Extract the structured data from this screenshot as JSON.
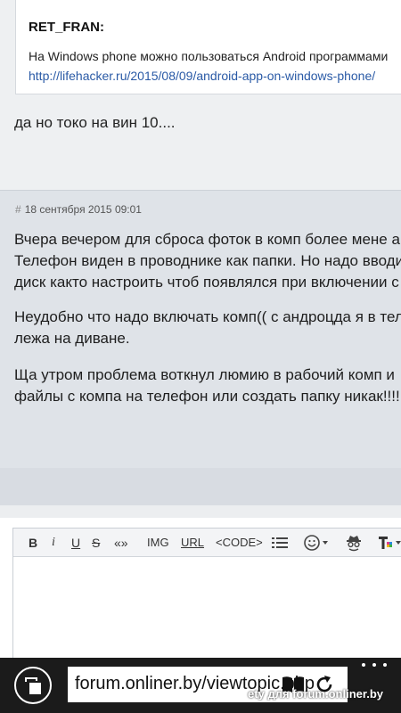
{
  "post1": {
    "quote_author": "RET_FRAN:",
    "quote_text": "На Windows phone можно пользоваться Android программами",
    "quote_link": "http://lifehacker.ru/2015/08/09/android-app-on-windows-phone/",
    "reply_text": "да но токо на вин 10...."
  },
  "post2": {
    "hash": "#",
    "date": "18 сентября 2015 09:01",
    "paragraphs": [
      [
        "Вчера вечером для сброса фоток в комп более мене а",
        "Телефон виден в проводнике как папки. Но надо вводи",
        "диск както настроить чтоб появлялся при включении с"
      ],
      [
        "Неудобно что надо включать комп(( с андроцда я в тел",
        "лежа на диване."
      ],
      [
        "Ща утром проблема воткнул люмию в рабочий комп и",
        "файлы с компа на телефон или создать папку никак!!!!"
      ]
    ]
  },
  "editor_toolbar": {
    "bold": "B",
    "italic": "i",
    "underline": "U",
    "strike": "S",
    "quote": "«»",
    "img": "IMG",
    "url": "URL",
    "code": "<CODE>"
  },
  "browser": {
    "url": "forum.onliner.by/viewtopic.php",
    "watermark": "ety для forum.onliner.by"
  }
}
